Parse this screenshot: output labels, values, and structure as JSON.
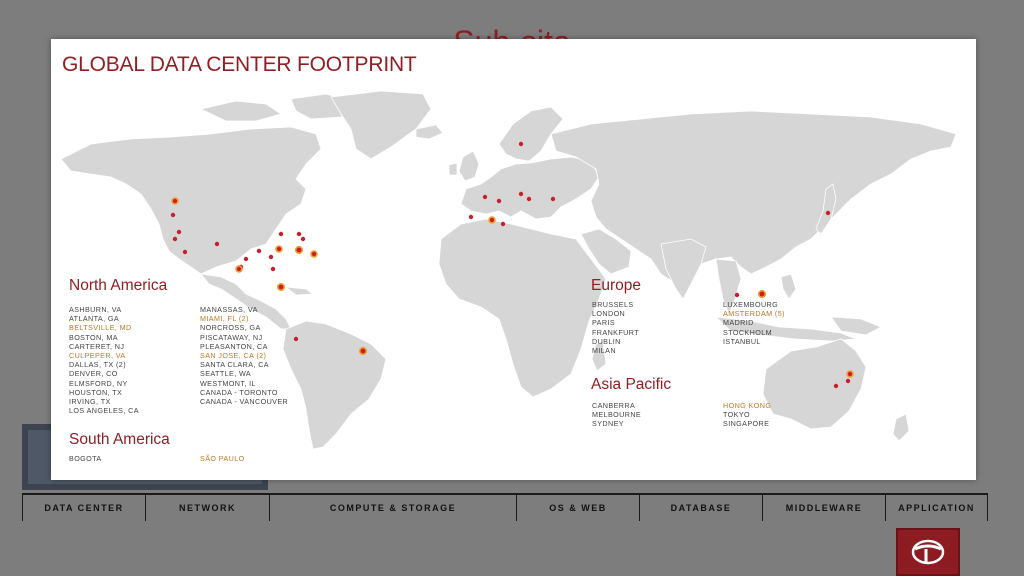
{
  "background_title": "Sub-site",
  "slide": {
    "title": "GLOBAL DATA CENTER FOOTPRINT",
    "regions": {
      "north_america": {
        "heading": "North America",
        "col1": [
          {
            "text": "ASHBURN, VA",
            "hl": false
          },
          {
            "text": "ATLANTA, GA",
            "hl": false
          },
          {
            "text": "BELTSVILLE, MD",
            "hl": true
          },
          {
            "text": "BOSTON, MA",
            "hl": false
          },
          {
            "text": "CARTERET, NJ",
            "hl": false
          },
          {
            "text": "CULPEPER, VA",
            "hl": true
          },
          {
            "text": "DALLAS, TX (2)",
            "hl": false
          },
          {
            "text": "DENVER, CO",
            "hl": false
          },
          {
            "text": "ELMSFORD, NY",
            "hl": false
          },
          {
            "text": "HOUSTON, TX",
            "hl": false
          },
          {
            "text": "IRVING, TX",
            "hl": false
          },
          {
            "text": "LOS ANGELES, CA",
            "hl": false
          }
        ],
        "col2": [
          {
            "text": "MANASSAS, VA",
            "hl": false
          },
          {
            "text": "MIAMI, FL (2)",
            "hl": true
          },
          {
            "text": "NORCROSS, GA",
            "hl": false
          },
          {
            "text": "PISCATAWAY, NJ",
            "hl": false
          },
          {
            "text": "PLEASANTON, CA",
            "hl": false
          },
          {
            "text": "SAN JOSE, CA (2)",
            "hl": true
          },
          {
            "text": "SANTA CLARA, CA",
            "hl": false
          },
          {
            "text": "SEATTLE, WA",
            "hl": false
          },
          {
            "text": "WESTMONT, IL",
            "hl": false
          },
          {
            "text": "CANADA - TORONTO",
            "hl": false
          },
          {
            "text": "CANADA - VANCOUVER",
            "hl": false
          }
        ]
      },
      "south_america": {
        "heading": "South America",
        "col1": [
          {
            "text": "BOGOTA",
            "hl": false
          }
        ],
        "col2": [
          {
            "text": "SÃO PAULO",
            "hl": true
          }
        ]
      },
      "europe": {
        "heading": "Europe",
        "col1": [
          {
            "text": "BRUSSELS",
            "hl": false
          },
          {
            "text": "LONDON",
            "hl": false
          },
          {
            "text": "PARIS",
            "hl": false
          },
          {
            "text": "FRANKFURT",
            "hl": false
          },
          {
            "text": "DUBLIN",
            "hl": false
          },
          {
            "text": "MILAN",
            "hl": false
          }
        ],
        "col2": [
          {
            "text": "LUXEMBOURG",
            "hl": false
          },
          {
            "text": "AMSTERDAM (5)",
            "hl": true
          },
          {
            "text": "MADRID",
            "hl": false
          },
          {
            "text": "STOCKHOLM",
            "hl": false
          },
          {
            "text": "ISTANBUL",
            "hl": false
          }
        ]
      },
      "asia_pacific": {
        "heading": "Asia Pacific",
        "col1": [
          {
            "text": "CANBERRA",
            "hl": false
          },
          {
            "text": "MELBOURNE",
            "hl": false
          },
          {
            "text": "SYDNEY",
            "hl": false
          }
        ],
        "col2": [
          {
            "text": "HONG KONG",
            "hl": true
          },
          {
            "text": "TOKYO",
            "hl": false
          },
          {
            "text": "SINGAPORE",
            "hl": false
          }
        ]
      }
    }
  },
  "layer_bar": [
    "DATA CENTER",
    "NETWORK",
    "COMPUTE & STORAGE",
    "OS & WEB",
    "DATABASE",
    "MIDDLEWARE",
    "APPLICATION"
  ],
  "colors": {
    "accent": "#8f1f24",
    "highlight": "#c07820",
    "land": "#d6d6d6",
    "marker": "#c8202a",
    "marker_ring": "#f0a030"
  }
}
